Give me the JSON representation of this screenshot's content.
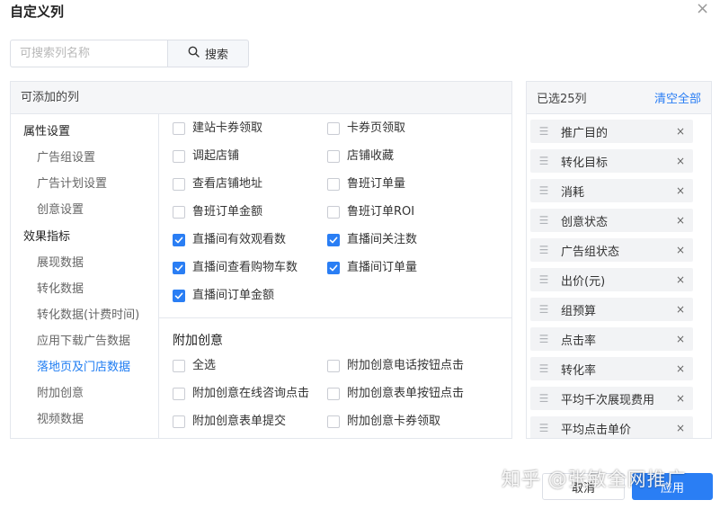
{
  "dialog": {
    "title": "自定义列",
    "close_icon": "close-icon"
  },
  "search": {
    "placeholder": "可搜索列名称",
    "value": "",
    "button_label": "搜索",
    "icon": "search-icon"
  },
  "available": {
    "header": "可添加的列",
    "categories": [
      {
        "label": "属性设置",
        "type": "group",
        "active": false
      },
      {
        "label": "广告组设置",
        "type": "sub",
        "active": false
      },
      {
        "label": "广告计划设置",
        "type": "sub",
        "active": false
      },
      {
        "label": "创意设置",
        "type": "sub",
        "active": false
      },
      {
        "label": "效果指标",
        "type": "group",
        "active": false
      },
      {
        "label": "展现数据",
        "type": "sub",
        "active": false
      },
      {
        "label": "转化数据",
        "type": "sub",
        "active": false
      },
      {
        "label": "转化数据(计费时间)",
        "type": "sub",
        "active": false
      },
      {
        "label": "应用下载广告数据",
        "type": "sub",
        "active": false
      },
      {
        "label": "落地页及门店数据",
        "type": "sub",
        "active": true
      },
      {
        "label": "附加创意",
        "type": "sub",
        "active": false
      },
      {
        "label": "视频数据",
        "type": "sub",
        "active": false
      }
    ],
    "options": [
      {
        "label": "建站卡券领取",
        "checked": false
      },
      {
        "label": "卡券页领取",
        "checked": false
      },
      {
        "label": "调起店铺",
        "checked": false
      },
      {
        "label": "店铺收藏",
        "checked": false
      },
      {
        "label": "查看店铺地址",
        "checked": false
      },
      {
        "label": "鲁班订单量",
        "checked": false
      },
      {
        "label": "鲁班订单金额",
        "checked": false
      },
      {
        "label": "鲁班订单ROI",
        "checked": false
      },
      {
        "label": "直播间有效观看数",
        "checked": true
      },
      {
        "label": "直播间关注数",
        "checked": true
      },
      {
        "label": "直播间查看购物车数",
        "checked": true
      },
      {
        "label": "直播间订单量",
        "checked": true
      },
      {
        "label": "直播间订单金额",
        "checked": true
      }
    ],
    "section2": {
      "title": "附加创意",
      "options": [
        {
          "label": "全选",
          "checked": false
        },
        {
          "label": "附加创意电话按钮点击",
          "checked": false
        },
        {
          "label": "附加创意在线咨询点击",
          "checked": false
        },
        {
          "label": "附加创意表单按钮点击",
          "checked": false
        },
        {
          "label": "附加创意表单提交",
          "checked": false
        },
        {
          "label": "附加创意卡券领取",
          "checked": false
        }
      ]
    }
  },
  "selected": {
    "count_label": "已选25列",
    "clear_label": "清空全部",
    "items": [
      {
        "label": "推广目的"
      },
      {
        "label": "转化目标"
      },
      {
        "label": "消耗"
      },
      {
        "label": "创意状态"
      },
      {
        "label": "广告组状态"
      },
      {
        "label": "出价(元)"
      },
      {
        "label": "组预算"
      },
      {
        "label": "点击率"
      },
      {
        "label": "转化率"
      },
      {
        "label": "平均千次展现费用"
      },
      {
        "label": "平均点击单价"
      }
    ],
    "remove_glyph": "×",
    "drag_glyph": "☰"
  },
  "footer": {
    "cancel_label": "取消",
    "apply_label": "应用"
  },
  "watermark": "知乎 @张敏全网推广",
  "colors": {
    "accent": "#2a7ef4",
    "active_category": "#1e7cf2"
  }
}
